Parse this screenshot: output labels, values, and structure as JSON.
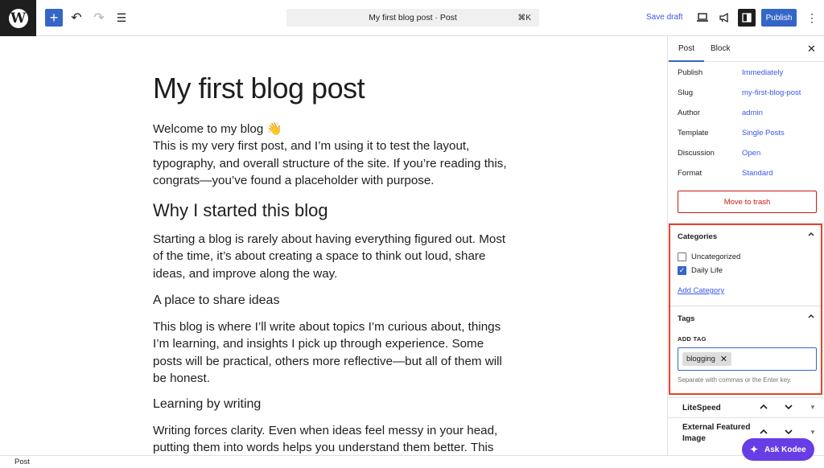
{
  "header": {
    "logo": "W",
    "add_label": "+",
    "undo_icon": "↶",
    "redo_icon": "↷",
    "list_view_icon": "☰",
    "document_title": "My first blog post · Post",
    "shortcut": "⌘K",
    "save_draft": "Save draft",
    "publish": "Publish",
    "more_icon": "⋮"
  },
  "post": {
    "title": "My first blog post",
    "intro_line1": "Welcome to my blog 👋",
    "intro_line2": "This is my very first post, and I’m using it to test the layout, typography, and overall structure of the site. If you’re reading this, congrats—you’ve found a placeholder with purpose.",
    "h2": "Why I started this blog",
    "p2": "Starting a blog is rarely about having everything figured out. Most of the time, it’s about creating a space to think out loud, share ideas, and improve along the way.",
    "h3a": "A place to share ideas",
    "p3": "This blog is where I’ll write about topics I’m curious about, things I’m learning, and insights I pick up through experience. Some posts will be practical, others more reflective—but all of them will be honest.",
    "h3b": "Learning by writing",
    "p4": "Writing forces clarity. Even when ideas feel messy in your head, putting them into words helps you understand them better. This"
  },
  "sidebar": {
    "tab_post": "Post",
    "tab_block": "Block",
    "close_icon": "✕",
    "meta": [
      {
        "label": "Publish",
        "value": "Immediately"
      },
      {
        "label": "Slug",
        "value": "my-first-blog-post"
      },
      {
        "label": "Author",
        "value": "admin"
      },
      {
        "label": "Template",
        "value": "Single Posts"
      },
      {
        "label": "Discussion",
        "value": "Open"
      },
      {
        "label": "Format",
        "value": "Standard"
      }
    ],
    "trash": "Move to trash",
    "categories": {
      "title": "Categories",
      "items": [
        {
          "label": "Uncategorized",
          "checked": false
        },
        {
          "label": "Daily Life",
          "checked": true
        }
      ],
      "add_link": "Add Category"
    },
    "tags": {
      "title": "Tags",
      "add_label": "ADD TAG",
      "chips": [
        "blogging"
      ],
      "help": "Separate with commas or the Enter key."
    },
    "litespeed": "LiteSpeed",
    "external_featured_image": "External Featured Image"
  },
  "footer": {
    "breadcrumb": "Post"
  },
  "assistant": {
    "label": "Ask Kodee"
  },
  "colors": {
    "accent": "#3566c6",
    "danger": "#cc1818",
    "highlight": "#e2452a",
    "kodee": "#673de6"
  }
}
